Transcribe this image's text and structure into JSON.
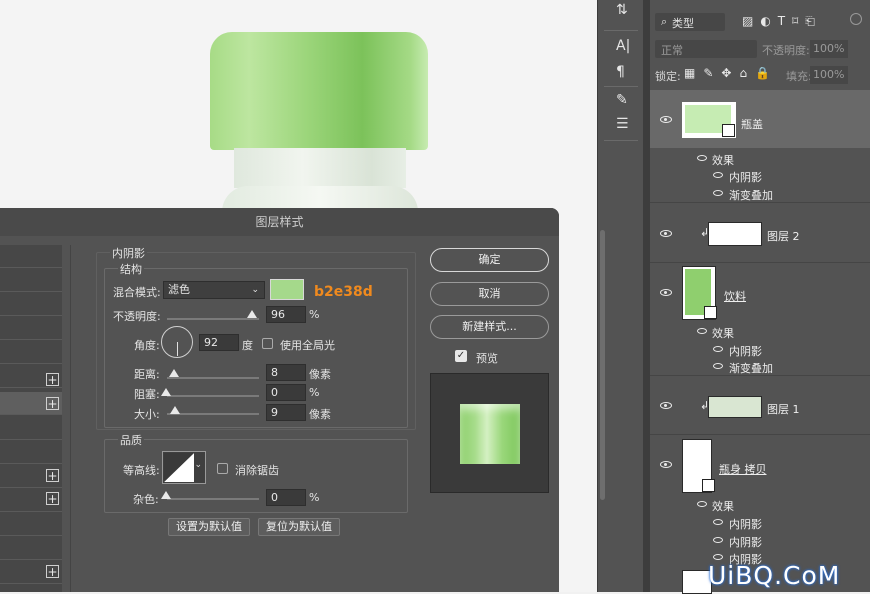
{
  "dialog": {
    "title": "图层样式",
    "section_title": "内阴影",
    "structure_label": "结构",
    "blend_mode_label": "混合模式:",
    "blend_mode_value": "滤色",
    "color_hex": "#a5d98b",
    "color_annotation": "b2e38d",
    "opacity_label": "不透明度:",
    "opacity_value": "96",
    "opacity_unit": "%",
    "opacity_fraction": 0.96,
    "angle_label": "角度:",
    "angle_value": "92",
    "angle_unit": "度",
    "global_light_label": "使用全局光",
    "distance_label": "距离:",
    "distance_value": "8",
    "distance_unit": "像素",
    "choke_label": "阻塞:",
    "choke_value": "0",
    "choke_unit": "%",
    "size_label": "大小:",
    "size_value": "9",
    "size_unit": "像素",
    "quality_label": "品质",
    "contour_label": "等高线:",
    "antialias_label": "消除锯齿",
    "noise_label": "杂色:",
    "noise_value": "0",
    "noise_unit": "%",
    "set_default_label": "设置为默认值",
    "reset_default_label": "复位为默认值",
    "ok_label": "确定",
    "cancel_label": "取消",
    "new_style_label": "新建样式...",
    "preview_label": "预览",
    "preview_checked": true
  },
  "layers_panel": {
    "filter_kind": "类型",
    "blend_mode": "正常",
    "opacity_label": "不透明度:",
    "opacity_value": "100%",
    "lock_label": "锁定:",
    "fill_label": "填充:",
    "fill_value": "100%",
    "layers": [
      {
        "name": "瓶盖",
        "effects_label": "效果",
        "effects": [
          "内阴影",
          "渐变叠加"
        ]
      },
      {
        "name": "图层 2"
      },
      {
        "name": "饮料",
        "effects_label": "效果",
        "effects": [
          "内阴影",
          "渐变叠加"
        ]
      },
      {
        "name": "图层 1"
      },
      {
        "name": "瓶身 拷贝",
        "effects_label": "效果",
        "effects": [
          "内阴影",
          "内阴影",
          "内阴影"
        ]
      }
    ]
  },
  "watermark": "UiBQ.CoM",
  "colors": {
    "accent_annotation": "#f08a1e",
    "cap_green": "#8fcf6e",
    "panel_bg": "#535353"
  }
}
